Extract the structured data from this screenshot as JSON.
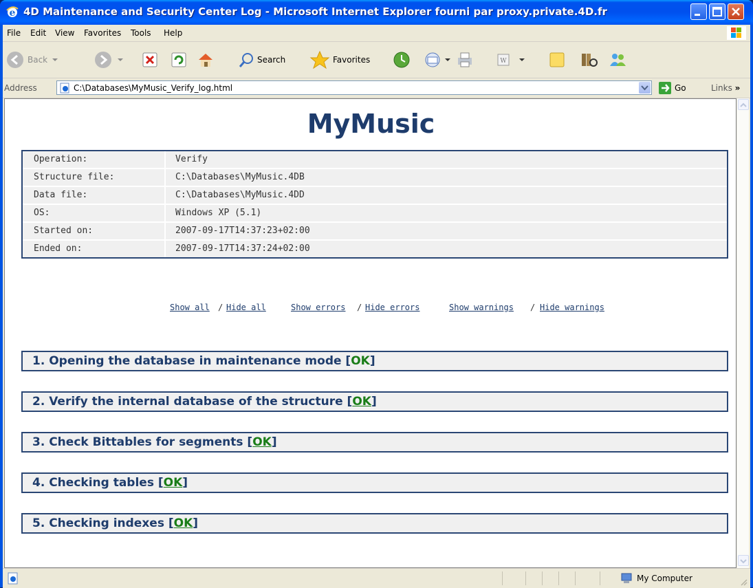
{
  "window": {
    "title": "4D Maintenance and Security Center Log - Microsoft Internet Explorer fourni par proxy.private.4D.fr"
  },
  "menubar": {
    "items": [
      "File",
      "Edit",
      "View",
      "Favorites",
      "Tools",
      "Help"
    ]
  },
  "toolbar": {
    "back_label": "Back",
    "search_label": "Search",
    "favorites_label": "Favorites"
  },
  "addressbar": {
    "label": "Address",
    "url": "C:\\Databases\\MyMusic_Verify_log.html",
    "go_label": "Go",
    "links_label": "Links"
  },
  "page": {
    "title": "MyMusic",
    "info": [
      {
        "key": "Operation:",
        "value": "Verify"
      },
      {
        "key": "Structure file:",
        "value": "C:\\Databases\\MyMusic.4DB"
      },
      {
        "key": "Data file:",
        "value": "C:\\Databases\\MyMusic.4DD"
      },
      {
        "key": "OS:",
        "value": "Windows XP (5.1)"
      },
      {
        "key": "Started on:",
        "value": "2007-09-17T14:37:23+02:00"
      },
      {
        "key": "Ended on:",
        "value": "2007-09-17T14:37:24+02:00"
      }
    ],
    "toggles": {
      "show_all": "Show all",
      "hide_all": "Hide all",
      "show_errors": "Show errors",
      "hide_errors": "Hide errors",
      "show_warnings": "Show warnings",
      "hide_warnings": "Hide warnings",
      "separator": "/"
    },
    "steps": [
      {
        "text": "1. Opening the database in maintenance mode",
        "status": "OK",
        "status_linked": false
      },
      {
        "text": "2. Verify the internal database of the structure",
        "status": "OK",
        "status_linked": true
      },
      {
        "text": "3. Check Bittables for segments",
        "status": "OK",
        "status_linked": true
      },
      {
        "text": "4. Checking tables",
        "status": "OK",
        "status_linked": true
      },
      {
        "text": "5. Checking indexes",
        "status": "OK",
        "status_linked": true
      }
    ]
  },
  "statusbar": {
    "zone": "My Computer"
  },
  "colors": {
    "title_blue": "#1e3c6c",
    "ok_green": "#1a7d18",
    "border_navy": "#2a4674"
  }
}
